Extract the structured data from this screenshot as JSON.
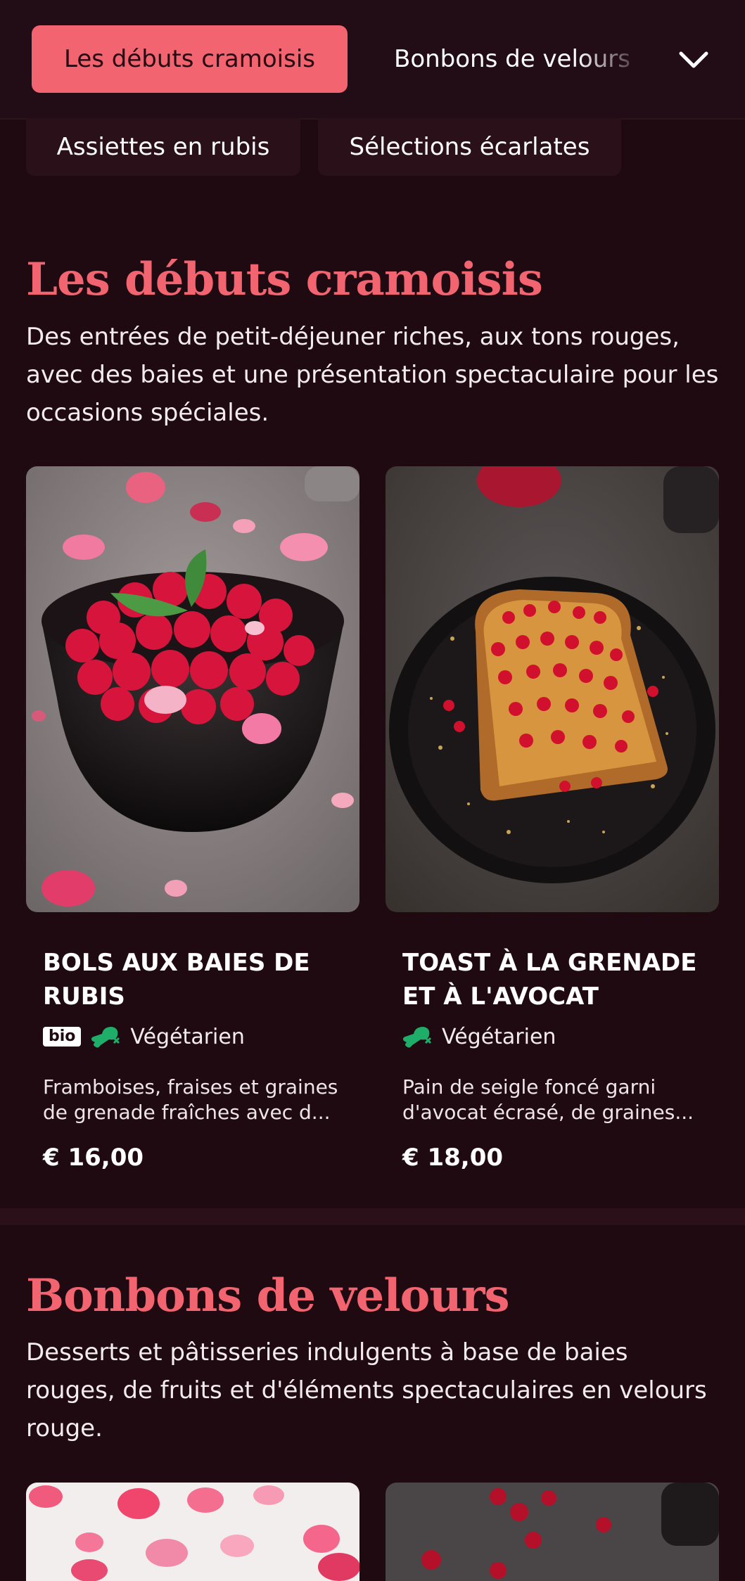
{
  "nav": {
    "active_category": "Les débuts cramoisis",
    "next_category": "Bonbons de velours",
    "row2": [
      "Assiettes en rubis",
      "Sélections écarlates"
    ]
  },
  "sections": [
    {
      "title": "Les débuts cramoisis",
      "description": "Des entrées de petit-déjeuner riches, aux tons rouges, avec des baies et une présentation spectaculaire pour les occasions spéciales.",
      "items": [
        {
          "name": "Bols aux baies de rubis",
          "bio_badge": "bio",
          "diet": "Végétarien",
          "description": "Framboises, fraises et graines de grenade fraîches avec d...",
          "price": "€ 16,00"
        },
        {
          "name": "Toast à la grenade et à l'avocat",
          "diet": "Végétarien",
          "description": "Pain de seigle foncé garni d'avocat écrasé, de graines...",
          "price": "€ 18,00"
        }
      ]
    },
    {
      "title": "Bonbons de velours",
      "description": "Desserts et pâtisseries indulgents à base de baies rouges, de fruits et d'éléments spectaculaires en velours rouge."
    }
  ],
  "colors": {
    "accent": "#f26470",
    "background": "#1f0a12",
    "diet_icon": "#1fae6a"
  },
  "icons": [
    "chevron-down-icon",
    "vegetarian-leg-icon"
  ]
}
